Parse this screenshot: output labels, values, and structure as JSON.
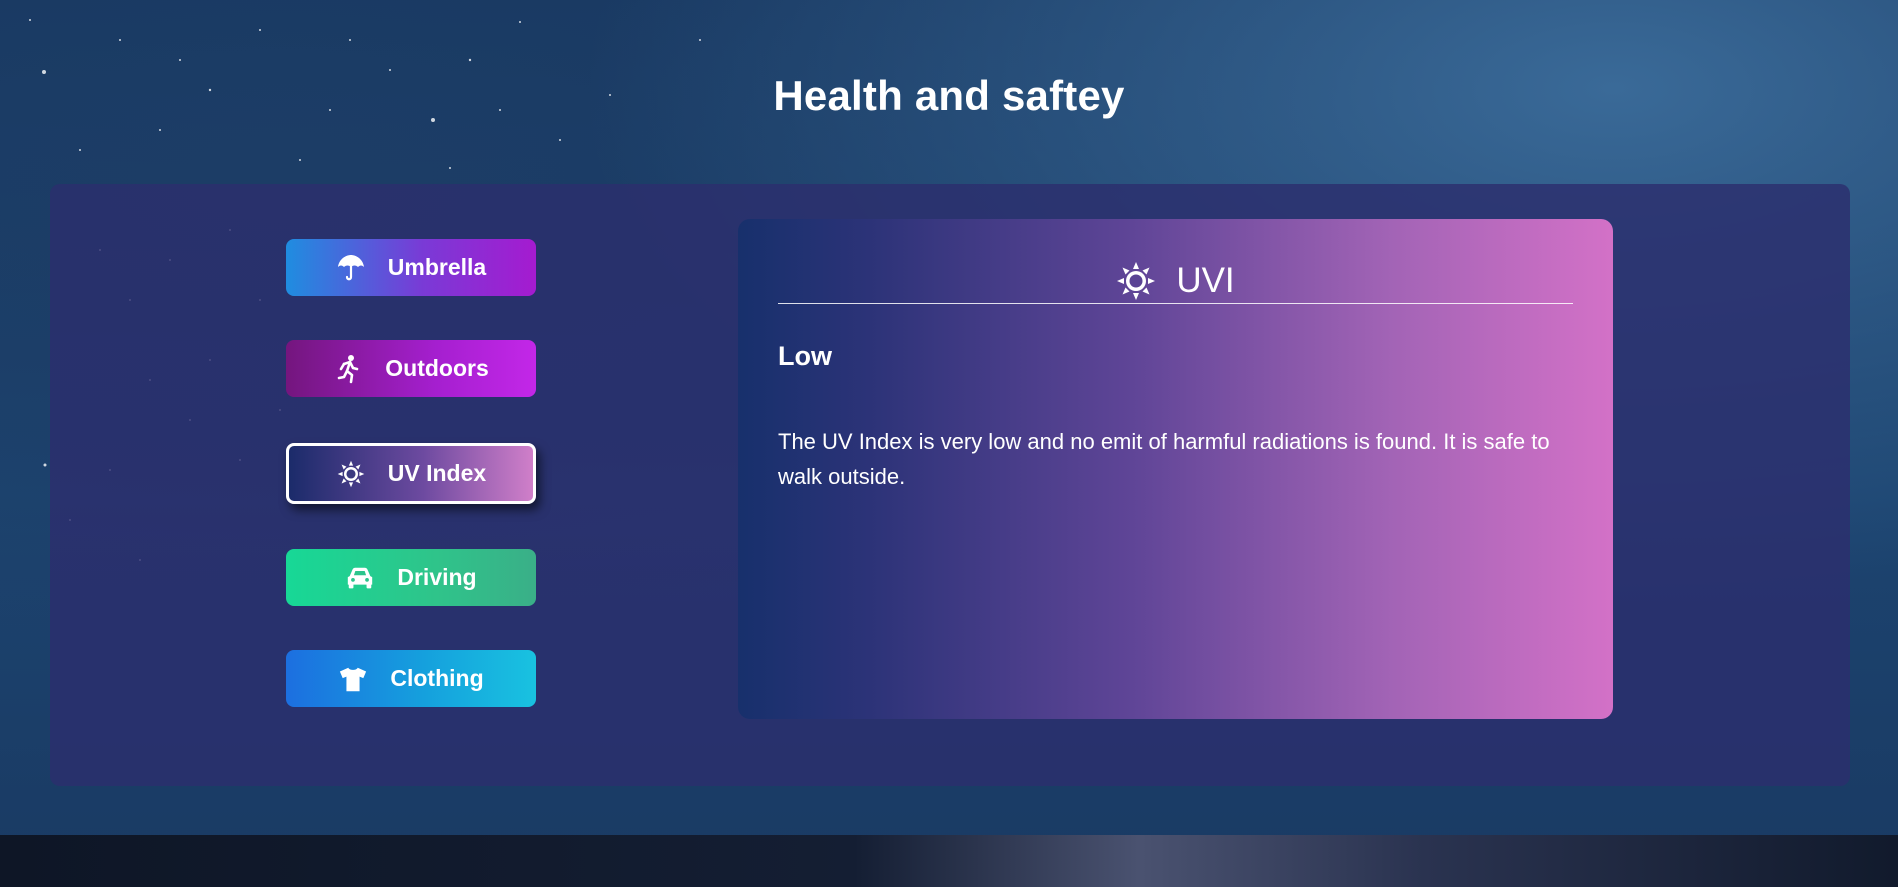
{
  "page": {
    "title": "Health and saftey"
  },
  "nav": {
    "items": [
      {
        "label": "Umbrella",
        "icon": "umbrella-icon"
      },
      {
        "label": "Outdoors",
        "icon": "running-person-icon"
      },
      {
        "label": "UV Index",
        "icon": "sun-icon",
        "selected": true
      },
      {
        "label": "Driving",
        "icon": "car-icon"
      },
      {
        "label": "Clothing",
        "icon": "t-shirt-icon"
      }
    ]
  },
  "detail": {
    "title": "UVI",
    "icon": "sun-icon",
    "level": "Low",
    "description": "The UV Index is very low and no emit of harmful radiations is found. It is safe to walk outside."
  },
  "colors": {
    "panel": "#2c2e6e",
    "umbrella_gradient": [
      "#1f8de0",
      "#a51bd0"
    ],
    "outdoors_gradient": [
      "#74167e",
      "#c327e8"
    ],
    "uv_gradient": [
      "#1b2b6a",
      "#d07fc9"
    ],
    "driving_gradient": [
      "#17d896",
      "#3aaf88"
    ],
    "clothing_gradient": [
      "#1c6fe0",
      "#19c2e0"
    ],
    "card_gradient": [
      "#17306c",
      "#d371c7"
    ]
  }
}
